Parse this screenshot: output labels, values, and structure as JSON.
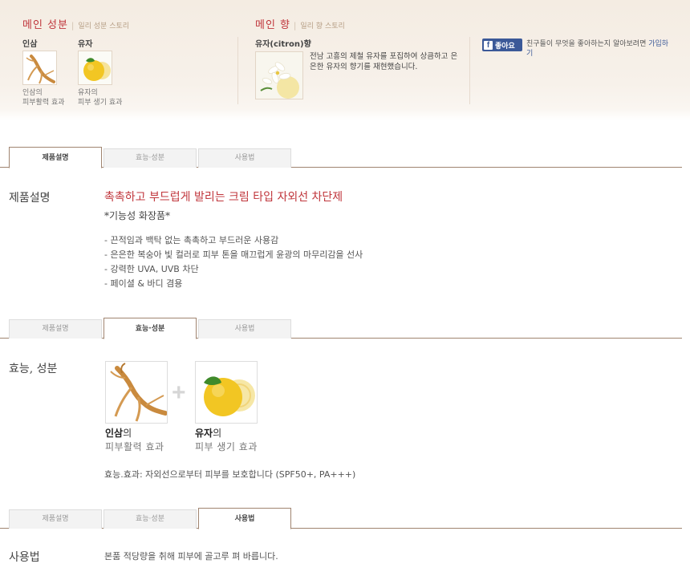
{
  "banner": {
    "main_ingredient": {
      "title": "메인 성분",
      "subtitle": "일리 성분 스토리"
    },
    "ingredients": [
      {
        "name": "인삼",
        "caption1": "인삼의",
        "caption2": "피부활력 효과",
        "icon": "ginseng-icon"
      },
      {
        "name": "유자",
        "caption1": "유자의",
        "caption2": "피부 생기 효과",
        "icon": "citron-icon"
      }
    ],
    "main_scent": {
      "title": "메인 향",
      "subtitle": "일리 향 스토리",
      "name": "유자(citron)향",
      "description": "전남 고흥의 제철 유자를 포집하여 상큼하고 은은한 유자의 향기를 재현했습니다.",
      "icon": "citron-flower-icon"
    },
    "facebook": {
      "like_label": "좋아요",
      "text": "친구들이 무엇을 좋아하는지 알아보려면 ",
      "link": "가입하기"
    }
  },
  "tabs": [
    {
      "label": "제품설명"
    },
    {
      "label": "효능·성분"
    },
    {
      "label": "사용법"
    }
  ],
  "description": {
    "title": "제품설명",
    "headline": "촉촉하고 부드럽게 발리는 크림 타입 자외선 차단제",
    "subhead": "*기능성 화장품*",
    "bullets": [
      "- 끈적임과 백탁 없는 촉촉하고 부드러운 사용감",
      "- 은은한 복숭아 빛 컬러로 피부 톤을 매끄럽게 윤광의 마무리감을 선사",
      "- 강력한 UVA, UVB 차단",
      "- 페이셜 & 바디 겸용"
    ]
  },
  "efficacy": {
    "title": "효능, 성분",
    "plus": "+",
    "ingredients": [
      {
        "name": "인삼",
        "suffix": "의",
        "desc": "피부활력 효과"
      },
      {
        "name": "유자",
        "suffix": "의",
        "desc": "피부 생기 효과"
      }
    ],
    "statement": "효능.효과: 자외선으로부터 피부를 보호합니다 (SPF50+, PA+++)"
  },
  "usage": {
    "title": "사용법",
    "text": "본품 적당량을 취해 피부에 골고루 펴 바릅니다."
  },
  "colors": {
    "accent": "#c0363c",
    "tab_border": "#a08470",
    "facebook": "#3b5998"
  }
}
